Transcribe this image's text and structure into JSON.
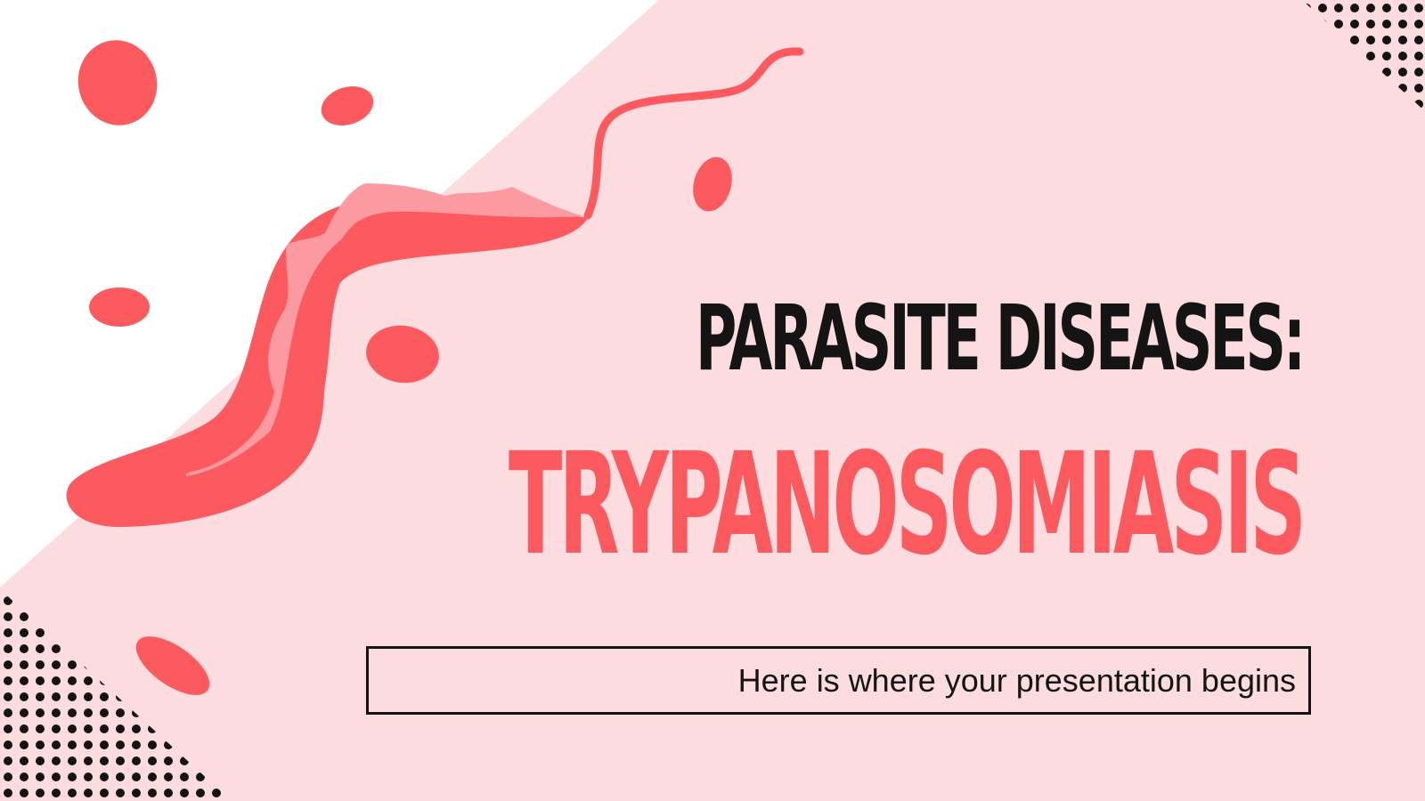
{
  "slide": {
    "title_line1": "PARASITE DISEASES:",
    "title_line2": "TRYPANOSOMIASIS",
    "subtitle": "Here is where your presentation begins"
  },
  "colors": {
    "background": "#ffffff",
    "pink_panel": "#fddcdf",
    "accent_red": "#fc5a5e",
    "light_red": "#fc9aa1",
    "text_dark": "#141414"
  },
  "decorations": {
    "parasite_illustration": "trypanosome-parasite",
    "blood_cells": "red-blood-cells",
    "dot_patterns": "halftone-dots"
  }
}
